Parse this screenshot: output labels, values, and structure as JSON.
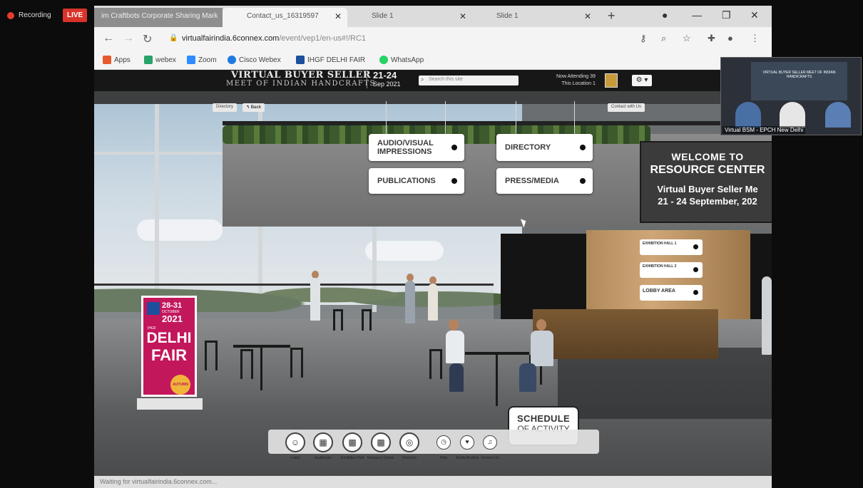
{
  "recorder": {
    "recording_label": "Recording",
    "live_label": "LIVE"
  },
  "browser": {
    "tabs": [
      {
        "title": "im Craftbots Corporate Sharing Mark"
      },
      {
        "title": "Contact_us_16319597"
      },
      {
        "title": "Slide 1"
      },
      {
        "title": "Slide 1"
      }
    ],
    "new_tab": "+",
    "url_host": "virtualfairindia.6connex.com",
    "url_path": "/event/vep1/en-us#!/RC1",
    "bookmarks": [
      {
        "label": "Apps",
        "color": "#e65a2c"
      },
      {
        "label": "webex",
        "color": "#27a36a"
      },
      {
        "label": "Zoom",
        "color": "#2d8cff"
      },
      {
        "label": "Cisco Webex",
        "color": "#1f7ae0"
      },
      {
        "label": "IHGF DELHI FAIR",
        "color": "#1d4f9c"
      },
      {
        "label": "WhatsApp",
        "color": "#25d366"
      }
    ],
    "status_text": "Waiting for virtualfairindia.6connex.com..."
  },
  "site": {
    "title": "VIRTUAL BUYER SELLER",
    "subtitle": "MEET OF INDIAN HANDCRAFTS",
    "dates": "21-24",
    "month": "Sep 2021",
    "search_placeholder": "Search this site",
    "now_attending": "Now Attending 39",
    "this_location": "This Location 1",
    "settings": "⚙ ▾",
    "sub_left": "Directory",
    "sub_back": "↰ Back",
    "sub_right": "Contact with Us"
  },
  "hotspots": {
    "audio_visual": "AUDIO/VISUAL IMPRESSIONS",
    "publications": "PUBLICATIONS",
    "directory": "DIRECTORY",
    "press_media": "PRESS/MEDIA",
    "exhibition_hall_1": "EXHIBITION HALL 1",
    "exhibition_hall_2": "EXHIBITION HALL 2",
    "lobby_area": "LOBBY AREA"
  },
  "welcome": {
    "line1": "WELCOME TO",
    "line2": "RESOURCE CENTER",
    "line3": "Virtual Buyer Seller Me",
    "line4": "21 - 24 September, 202"
  },
  "standee": {
    "dates": "28-31",
    "month": "OCTOBER",
    "year": "2021",
    "org": "IHGF",
    "line1": "DELHI",
    "line2": "FAIR",
    "badge": "AUTUMN"
  },
  "schedule": {
    "line1": "SCHEDULE",
    "line2": "OF ACTIVITY"
  },
  "dock": [
    {
      "icon": "☺",
      "label": "Lobby"
    },
    {
      "icon": "▦",
      "label": "Auditorium"
    },
    {
      "icon": "▩",
      "label": "Exhibition Hall"
    },
    {
      "icon": "▩",
      "label": "Resource Center"
    },
    {
      "icon": "◎",
      "label": "Directory"
    },
    {
      "icon": "◷",
      "label": "Help"
    },
    {
      "icon": "♥",
      "label": "Media Briefing"
    },
    {
      "icon": "♫",
      "label": "Contact Us"
    }
  ],
  "video": {
    "screen_text": "VIRTUAL BUYER SELLER MEET OF INDIAN HANDICRAFTS",
    "caption": "Virtual BSM - EPCH New Delhi"
  }
}
